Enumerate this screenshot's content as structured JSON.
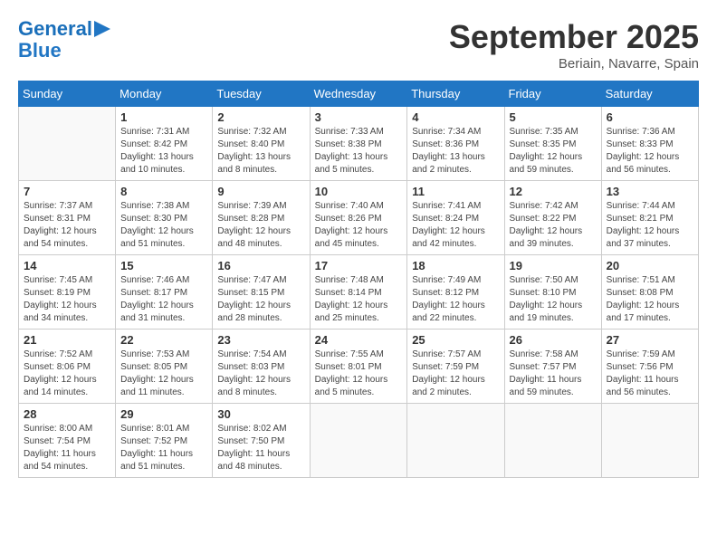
{
  "app": {
    "logo_line1": "General",
    "logo_line2": "Blue",
    "logo_icon": "▶"
  },
  "header": {
    "month": "September 2025",
    "location": "Beriain, Navarre, Spain"
  },
  "weekdays": [
    "Sunday",
    "Monday",
    "Tuesday",
    "Wednesday",
    "Thursday",
    "Friday",
    "Saturday"
  ],
  "weeks": [
    [
      {
        "day": "",
        "sunrise": "",
        "sunset": "",
        "daylight": ""
      },
      {
        "day": "1",
        "sunrise": "Sunrise: 7:31 AM",
        "sunset": "Sunset: 8:42 PM",
        "daylight": "Daylight: 13 hours and 10 minutes."
      },
      {
        "day": "2",
        "sunrise": "Sunrise: 7:32 AM",
        "sunset": "Sunset: 8:40 PM",
        "daylight": "Daylight: 13 hours and 8 minutes."
      },
      {
        "day": "3",
        "sunrise": "Sunrise: 7:33 AM",
        "sunset": "Sunset: 8:38 PM",
        "daylight": "Daylight: 13 hours and 5 minutes."
      },
      {
        "day": "4",
        "sunrise": "Sunrise: 7:34 AM",
        "sunset": "Sunset: 8:36 PM",
        "daylight": "Daylight: 13 hours and 2 minutes."
      },
      {
        "day": "5",
        "sunrise": "Sunrise: 7:35 AM",
        "sunset": "Sunset: 8:35 PM",
        "daylight": "Daylight: 12 hours and 59 minutes."
      },
      {
        "day": "6",
        "sunrise": "Sunrise: 7:36 AM",
        "sunset": "Sunset: 8:33 PM",
        "daylight": "Daylight: 12 hours and 56 minutes."
      }
    ],
    [
      {
        "day": "7",
        "sunrise": "Sunrise: 7:37 AM",
        "sunset": "Sunset: 8:31 PM",
        "daylight": "Daylight: 12 hours and 54 minutes."
      },
      {
        "day": "8",
        "sunrise": "Sunrise: 7:38 AM",
        "sunset": "Sunset: 8:30 PM",
        "daylight": "Daylight: 12 hours and 51 minutes."
      },
      {
        "day": "9",
        "sunrise": "Sunrise: 7:39 AM",
        "sunset": "Sunset: 8:28 PM",
        "daylight": "Daylight: 12 hours and 48 minutes."
      },
      {
        "day": "10",
        "sunrise": "Sunrise: 7:40 AM",
        "sunset": "Sunset: 8:26 PM",
        "daylight": "Daylight: 12 hours and 45 minutes."
      },
      {
        "day": "11",
        "sunrise": "Sunrise: 7:41 AM",
        "sunset": "Sunset: 8:24 PM",
        "daylight": "Daylight: 12 hours and 42 minutes."
      },
      {
        "day": "12",
        "sunrise": "Sunrise: 7:42 AM",
        "sunset": "Sunset: 8:22 PM",
        "daylight": "Daylight: 12 hours and 39 minutes."
      },
      {
        "day": "13",
        "sunrise": "Sunrise: 7:44 AM",
        "sunset": "Sunset: 8:21 PM",
        "daylight": "Daylight: 12 hours and 37 minutes."
      }
    ],
    [
      {
        "day": "14",
        "sunrise": "Sunrise: 7:45 AM",
        "sunset": "Sunset: 8:19 PM",
        "daylight": "Daylight: 12 hours and 34 minutes."
      },
      {
        "day": "15",
        "sunrise": "Sunrise: 7:46 AM",
        "sunset": "Sunset: 8:17 PM",
        "daylight": "Daylight: 12 hours and 31 minutes."
      },
      {
        "day": "16",
        "sunrise": "Sunrise: 7:47 AM",
        "sunset": "Sunset: 8:15 PM",
        "daylight": "Daylight: 12 hours and 28 minutes."
      },
      {
        "day": "17",
        "sunrise": "Sunrise: 7:48 AM",
        "sunset": "Sunset: 8:14 PM",
        "daylight": "Daylight: 12 hours and 25 minutes."
      },
      {
        "day": "18",
        "sunrise": "Sunrise: 7:49 AM",
        "sunset": "Sunset: 8:12 PM",
        "daylight": "Daylight: 12 hours and 22 minutes."
      },
      {
        "day": "19",
        "sunrise": "Sunrise: 7:50 AM",
        "sunset": "Sunset: 8:10 PM",
        "daylight": "Daylight: 12 hours and 19 minutes."
      },
      {
        "day": "20",
        "sunrise": "Sunrise: 7:51 AM",
        "sunset": "Sunset: 8:08 PM",
        "daylight": "Daylight: 12 hours and 17 minutes."
      }
    ],
    [
      {
        "day": "21",
        "sunrise": "Sunrise: 7:52 AM",
        "sunset": "Sunset: 8:06 PM",
        "daylight": "Daylight: 12 hours and 14 minutes."
      },
      {
        "day": "22",
        "sunrise": "Sunrise: 7:53 AM",
        "sunset": "Sunset: 8:05 PM",
        "daylight": "Daylight: 12 hours and 11 minutes."
      },
      {
        "day": "23",
        "sunrise": "Sunrise: 7:54 AM",
        "sunset": "Sunset: 8:03 PM",
        "daylight": "Daylight: 12 hours and 8 minutes."
      },
      {
        "day": "24",
        "sunrise": "Sunrise: 7:55 AM",
        "sunset": "Sunset: 8:01 PM",
        "daylight": "Daylight: 12 hours and 5 minutes."
      },
      {
        "day": "25",
        "sunrise": "Sunrise: 7:57 AM",
        "sunset": "Sunset: 7:59 PM",
        "daylight": "Daylight: 12 hours and 2 minutes."
      },
      {
        "day": "26",
        "sunrise": "Sunrise: 7:58 AM",
        "sunset": "Sunset: 7:57 PM",
        "daylight": "Daylight: 11 hours and 59 minutes."
      },
      {
        "day": "27",
        "sunrise": "Sunrise: 7:59 AM",
        "sunset": "Sunset: 7:56 PM",
        "daylight": "Daylight: 11 hours and 56 minutes."
      }
    ],
    [
      {
        "day": "28",
        "sunrise": "Sunrise: 8:00 AM",
        "sunset": "Sunset: 7:54 PM",
        "daylight": "Daylight: 11 hours and 54 minutes."
      },
      {
        "day": "29",
        "sunrise": "Sunrise: 8:01 AM",
        "sunset": "Sunset: 7:52 PM",
        "daylight": "Daylight: 11 hours and 51 minutes."
      },
      {
        "day": "30",
        "sunrise": "Sunrise: 8:02 AM",
        "sunset": "Sunset: 7:50 PM",
        "daylight": "Daylight: 11 hours and 48 minutes."
      },
      {
        "day": "",
        "sunrise": "",
        "sunset": "",
        "daylight": ""
      },
      {
        "day": "",
        "sunrise": "",
        "sunset": "",
        "daylight": ""
      },
      {
        "day": "",
        "sunrise": "",
        "sunset": "",
        "daylight": ""
      },
      {
        "day": "",
        "sunrise": "",
        "sunset": "",
        "daylight": ""
      }
    ]
  ]
}
